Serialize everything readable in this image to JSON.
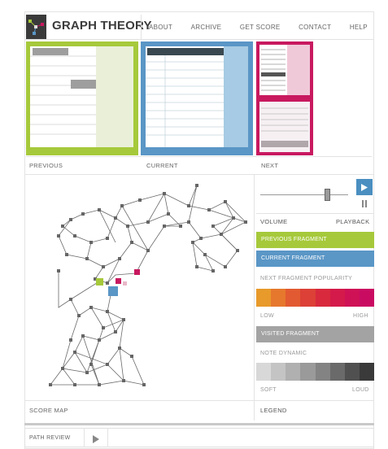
{
  "header": {
    "brand": "GRAPH THEORY",
    "logo_icon": "graph-logo-icon",
    "nav": [
      "ABOUT",
      "ARCHIVE",
      "GET SCORE",
      "CONTACT",
      "HELP"
    ]
  },
  "fragments": {
    "previous_label": "PREVIOUS",
    "current_label": "CURRENT",
    "next_label": "NEXT"
  },
  "score_map": {
    "label": "SCORE MAP"
  },
  "controls": {
    "volume_label": "VOLUME",
    "playback_label": "PLAYBACK",
    "volume_level": 0.8,
    "play_icon": "play-icon",
    "pause_icon": "pause-icon"
  },
  "legend": {
    "previous_fragment": "PREVIOUS FRAGMENT",
    "current_fragment": "CURRENT FRAGMENT",
    "next_popularity": "NEXT FRAGMENT POPULARITY",
    "popularity_colors": [
      "#e89a2a",
      "#e6782d",
      "#e25a31",
      "#dc4036",
      "#d8293d",
      "#d41a4a",
      "#cf1156",
      "#c90c62"
    ],
    "low": "LOW",
    "high": "HIGH",
    "visited_fragment": "VISITED FRAGMENT",
    "note_dynamic": "NOTE DYNAMIC",
    "dynamic_colors": [
      "#d8d8d8",
      "#c4c4c4",
      "#b0b0b0",
      "#9a9a9a",
      "#838383",
      "#6a6a6a",
      "#505050",
      "#3a3a3a"
    ],
    "soft": "SOFT",
    "loud": "LOUD",
    "legend_label": "LEGEND"
  },
  "colors": {
    "previous": "#a6c93b",
    "current": "#5a96c6",
    "next": "#c8195f",
    "visited": "#a3a3a3"
  },
  "path_review": {
    "label": "PATH REVIEW",
    "play_icon": "play-icon"
  }
}
